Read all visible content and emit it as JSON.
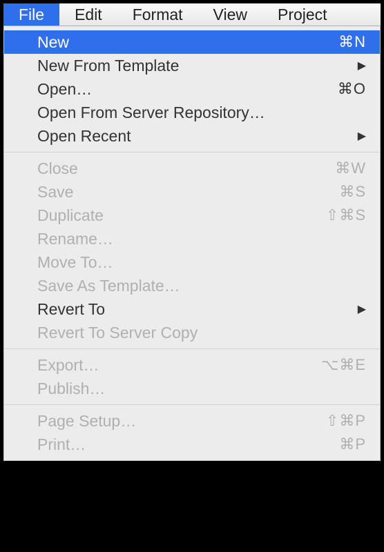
{
  "menubar": {
    "items": [
      {
        "label": "File",
        "active": true
      },
      {
        "label": "Edit",
        "active": false
      },
      {
        "label": "Format",
        "active": false
      },
      {
        "label": "View",
        "active": false
      },
      {
        "label": "Project",
        "active": false
      }
    ]
  },
  "dropdown": {
    "sections": [
      [
        {
          "label": "New",
          "shortcut": "⌘N",
          "highlighted": true,
          "disabled": false,
          "submenu": false
        },
        {
          "label": "New From Template",
          "shortcut": "",
          "highlighted": false,
          "disabled": false,
          "submenu": true
        },
        {
          "label": "Open…",
          "shortcut": "⌘O",
          "highlighted": false,
          "disabled": false,
          "submenu": false
        },
        {
          "label": "Open From Server Repository…",
          "shortcut": "",
          "highlighted": false,
          "disabled": false,
          "submenu": false
        },
        {
          "label": "Open Recent",
          "shortcut": "",
          "highlighted": false,
          "disabled": false,
          "submenu": true
        }
      ],
      [
        {
          "label": "Close",
          "shortcut": "⌘W",
          "highlighted": false,
          "disabled": true,
          "submenu": false
        },
        {
          "label": "Save",
          "shortcut": "⌘S",
          "highlighted": false,
          "disabled": true,
          "submenu": false
        },
        {
          "label": "Duplicate",
          "shortcut": "⇧⌘S",
          "highlighted": false,
          "disabled": true,
          "submenu": false
        },
        {
          "label": "Rename…",
          "shortcut": "",
          "highlighted": false,
          "disabled": true,
          "submenu": false
        },
        {
          "label": "Move To…",
          "shortcut": "",
          "highlighted": false,
          "disabled": true,
          "submenu": false
        },
        {
          "label": "Save As Template…",
          "shortcut": "",
          "highlighted": false,
          "disabled": true,
          "submenu": false
        },
        {
          "label": "Revert To",
          "shortcut": "",
          "highlighted": false,
          "disabled": false,
          "submenu": true
        },
        {
          "label": "Revert To Server Copy",
          "shortcut": "",
          "highlighted": false,
          "disabled": true,
          "submenu": false
        }
      ],
      [
        {
          "label": "Export…",
          "shortcut": "⌥⌘E",
          "highlighted": false,
          "disabled": true,
          "submenu": false
        },
        {
          "label": "Publish…",
          "shortcut": "",
          "highlighted": false,
          "disabled": true,
          "submenu": false
        }
      ],
      [
        {
          "label": "Page Setup…",
          "shortcut": "⇧⌘P",
          "highlighted": false,
          "disabled": true,
          "submenu": false
        },
        {
          "label": "Print…",
          "shortcut": "⌘P",
          "highlighted": false,
          "disabled": true,
          "submenu": false
        }
      ]
    ]
  }
}
